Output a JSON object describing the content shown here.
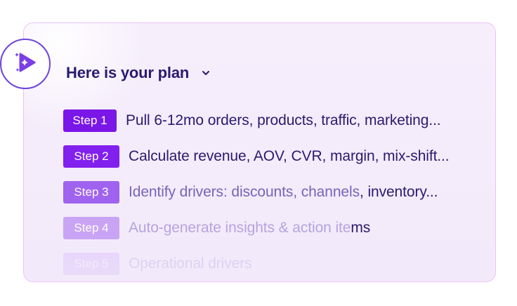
{
  "header": {
    "title": "Here is your plan",
    "toggle_icon": "chevron-down-icon"
  },
  "badge": {
    "icon": "sparkle-send-icon"
  },
  "colors": {
    "accent": "#7a16e8",
    "title": "#2a1b6e",
    "card_border": "#ecc3f4",
    "badge_ring": "#6d44d9"
  },
  "steps": [
    {
      "tag": "Step 1",
      "text": "Pull 6-12mo orders, products, traffic, marketing..."
    },
    {
      "tag": "Step 2",
      "text": "Calculate revenue, AOV, CVR, margin, mix-shift..."
    },
    {
      "tag": "Step 3",
      "text_a": "Identify drivers: discounts, channels",
      "text_b": ", inventory..."
    },
    {
      "tag": "Step 4",
      "text_a": "Auto-generate insights & action ite",
      "text_b": "ms"
    },
    {
      "tag": "Step 5",
      "text": "Operational drivers"
    }
  ]
}
